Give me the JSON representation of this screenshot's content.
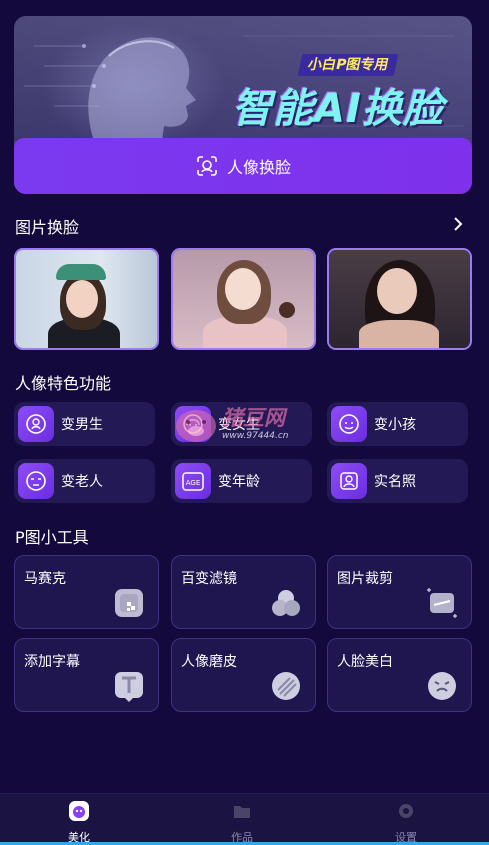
{
  "banner": {
    "subtitle": "小白P图专用",
    "title": "智能AI换脸",
    "button_label": "人像换脸"
  },
  "photo_swap": {
    "title": "图片换脸",
    "photos": [
      {
        "name": "photo-1"
      },
      {
        "name": "photo-2"
      },
      {
        "name": "photo-3"
      }
    ]
  },
  "features": {
    "title": "人像特色功能",
    "items": [
      {
        "label": "变男生",
        "icon": "male-face-icon"
      },
      {
        "label": "变女生",
        "icon": "female-face-icon"
      },
      {
        "label": "变小孩",
        "icon": "child-face-icon"
      },
      {
        "label": "变老人",
        "icon": "elder-face-icon"
      },
      {
        "label": "变年龄",
        "icon": "age-icon"
      },
      {
        "label": "实名照",
        "icon": "id-photo-icon"
      }
    ]
  },
  "tools": {
    "title": "P图小工具",
    "items": [
      {
        "label": "马赛克",
        "icon": "mosaic-icon"
      },
      {
        "label": "百变滤镜",
        "icon": "filter-icon"
      },
      {
        "label": "图片裁剪",
        "icon": "crop-icon"
      },
      {
        "label": "添加字幕",
        "icon": "text-icon"
      },
      {
        "label": "人像磨皮",
        "icon": "smooth-skin-icon"
      },
      {
        "label": "人脸美白",
        "icon": "whitening-icon"
      }
    ]
  },
  "nav": {
    "items": [
      {
        "label": "美化",
        "active": true
      },
      {
        "label": "作品",
        "active": false
      },
      {
        "label": "设置",
        "active": false
      }
    ]
  },
  "watermark": {
    "text": "猪豆网",
    "url": "www.97444.cn"
  },
  "colors": {
    "background": "#13093d",
    "accent": "#7b3af0",
    "card": "#231a55"
  }
}
